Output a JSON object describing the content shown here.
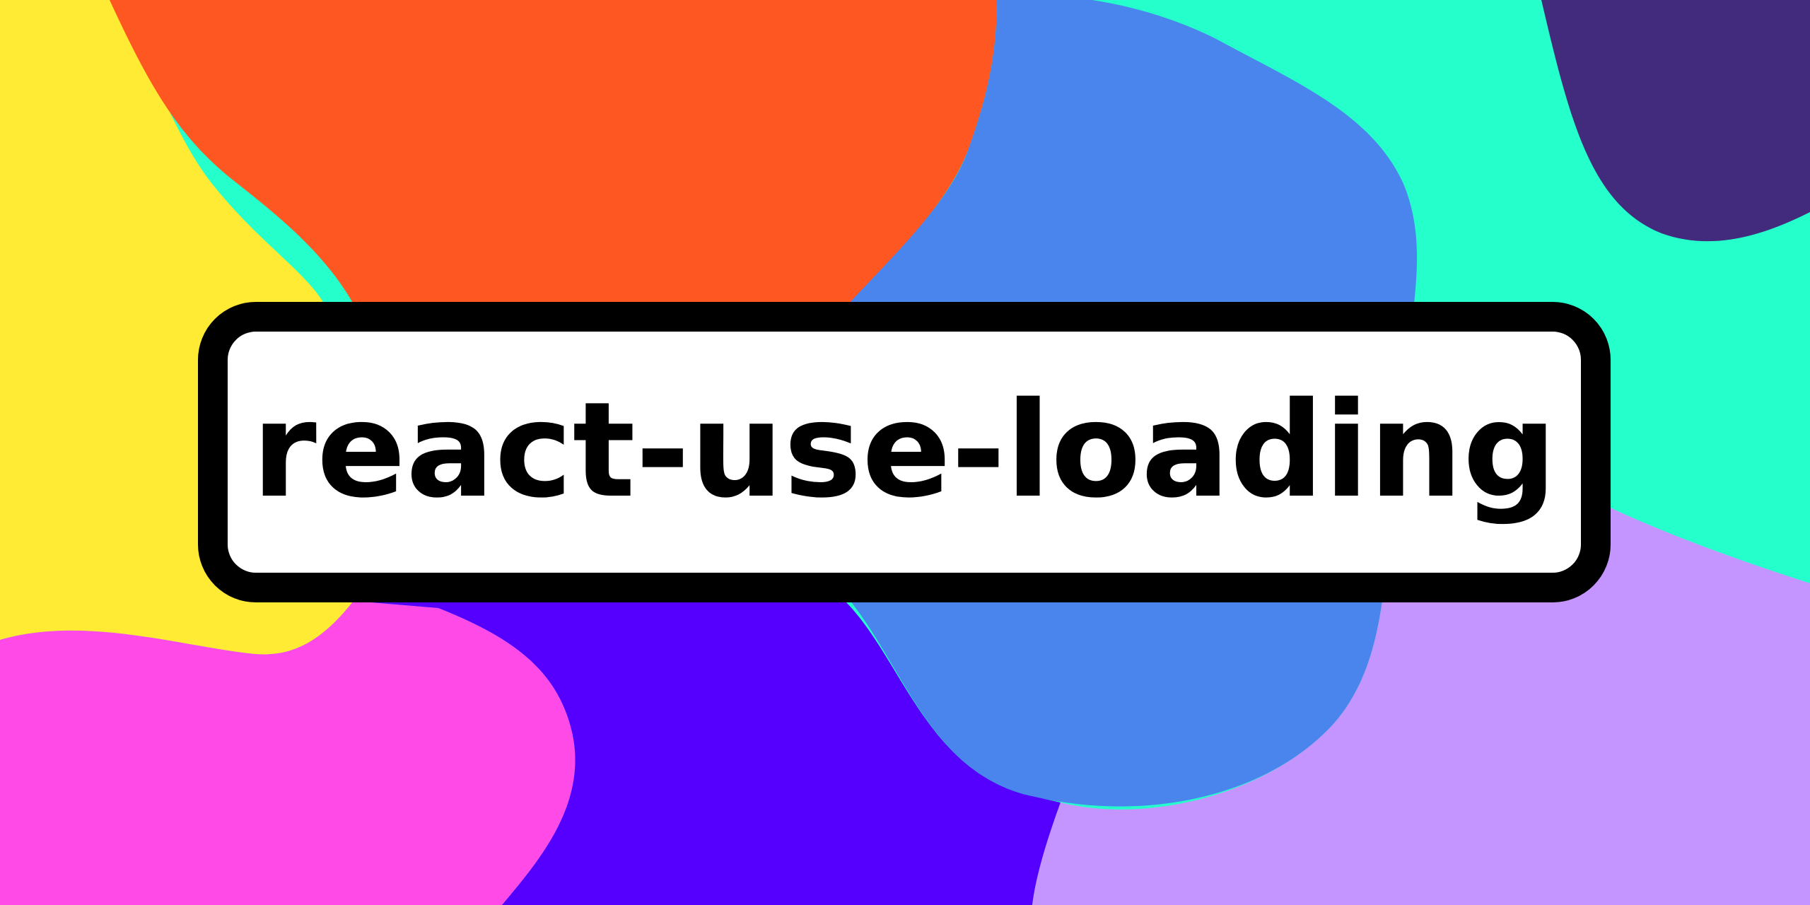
{
  "banner": {
    "title": "react-use-loading"
  },
  "colors": {
    "yellow": "#FFEB33",
    "orange": "#FF5722",
    "blue": "#4A85EE",
    "teal": "#24FFCB",
    "deep_purple": "#422B7C",
    "pink": "#FF4AE8",
    "violet": "#5500FF",
    "lavender": "#C595FF",
    "card_fill": "#FFFFFF",
    "card_border": "#000000",
    "text": "#000000"
  }
}
